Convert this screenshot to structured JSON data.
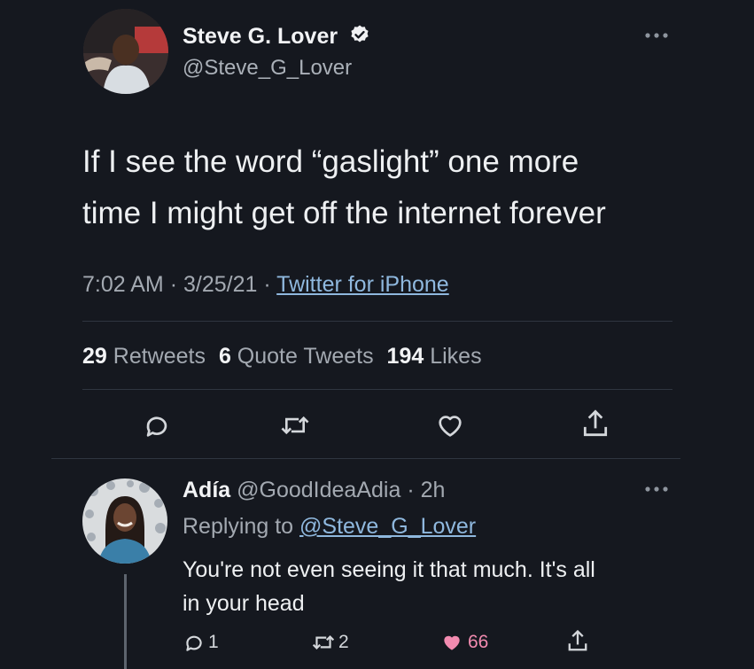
{
  "tweet": {
    "author_name": "Steve G. Lover",
    "author_handle": "@Steve_G_Lover",
    "text_line1": "If I see the word “gaslight” one more",
    "text_line2": "time I might get off the internet forever",
    "time": "7:02 AM",
    "date": "3/25/21",
    "separator": "·",
    "source": "Twitter for iPhone",
    "retweets_count": "29",
    "retweets_label": "Retweets",
    "quotes_count": "6",
    "quotes_label": "Quote Tweets",
    "likes_count": "194",
    "likes_label": "Likes"
  },
  "reply": {
    "author_name": "Adía",
    "author_handle": "@GoodIdeaAdia",
    "age": "· 2h",
    "replying_prefix": "Replying to",
    "replying_handle": "@Steve_G_Lover",
    "text_line1": "You're not even seeing it that much. It's all",
    "text_line2": "in your head",
    "reply_count": "1",
    "retweet_count": "2",
    "like_count": "66"
  },
  "colors": {
    "background": "#15181f",
    "link": "#8fb8de",
    "liked": "#f28bb0"
  },
  "icons": [
    "verified-icon",
    "more-icon",
    "reply-icon",
    "retweet-icon",
    "like-icon",
    "share-icon"
  ]
}
